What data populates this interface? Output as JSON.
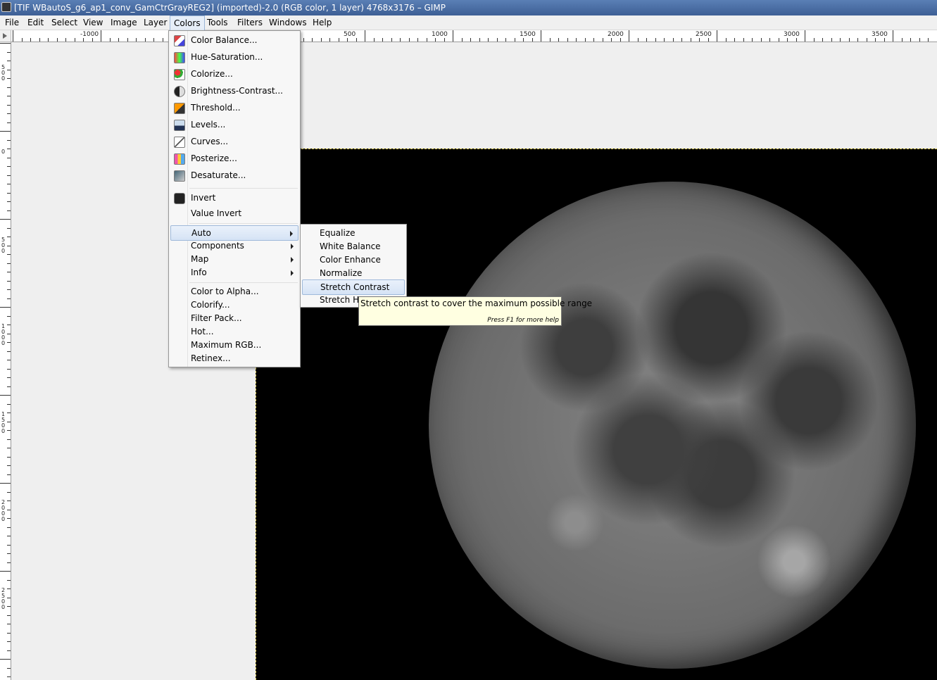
{
  "window": {
    "title": "[TIF WBautoS_g6_ap1_conv_GamCtrGrayREG2] (imported)-2.0 (RGB color, 1 layer) 4768x3176 – GIMP"
  },
  "menubar": {
    "items": [
      "File",
      "Edit",
      "Select",
      "View",
      "Image",
      "Layer",
      "Colors",
      "Tools",
      "Filters",
      "Windows",
      "Help"
    ],
    "active": "Colors"
  },
  "rulers": {
    "horizontal_labels": [
      "-1000",
      "500",
      "1000",
      "1500",
      "2000",
      "2500",
      "3000",
      "3500"
    ],
    "vertical_labels": [
      "500",
      "0",
      "500",
      "1000",
      "1500",
      "2000",
      "2500"
    ]
  },
  "colors_menu": {
    "items": [
      {
        "label": "Color Balance...",
        "icon": "color-balance-icon"
      },
      {
        "label": "Hue-Saturation...",
        "icon": "hue-saturation-icon"
      },
      {
        "label": "Colorize...",
        "icon": "colorize-icon"
      },
      {
        "label": "Brightness-Contrast...",
        "icon": "brightness-contrast-icon"
      },
      {
        "label": "Threshold...",
        "icon": "threshold-icon"
      },
      {
        "label": "Levels...",
        "icon": "levels-icon"
      },
      {
        "label": "Curves...",
        "icon": "curves-icon"
      },
      {
        "label": "Posterize...",
        "icon": "posterize-icon"
      },
      {
        "label": "Desaturate...",
        "icon": "desaturate-icon"
      },
      {
        "label": "Invert",
        "icon": "invert-icon"
      },
      {
        "label": "Value Invert",
        "icon": ""
      },
      {
        "label": "Auto",
        "submenu": true
      },
      {
        "label": "Components",
        "submenu": true
      },
      {
        "label": "Map",
        "submenu": true
      },
      {
        "label": "Info",
        "submenu": true
      },
      {
        "label": "Color to Alpha..."
      },
      {
        "label": "Colorify..."
      },
      {
        "label": "Filter Pack..."
      },
      {
        "label": "Hot..."
      },
      {
        "label": "Maximum RGB..."
      },
      {
        "label": "Retinex..."
      }
    ],
    "highlighted": "Auto"
  },
  "auto_submenu": {
    "items": [
      "Equalize",
      "White Balance",
      "Color Enhance",
      "Normalize",
      "Stretch Contrast",
      "Stretch HSV"
    ],
    "highlighted": "Stretch Contrast"
  },
  "tooltip": {
    "text": "Stretch contrast to cover the maximum possible range",
    "help": "Press F1 for more help"
  },
  "colors": {
    "titlebar": "#4a6ea5",
    "highlight": "#d5e3f5",
    "tooltip_bg": "#ffffe1",
    "image_bg": "#000000"
  }
}
